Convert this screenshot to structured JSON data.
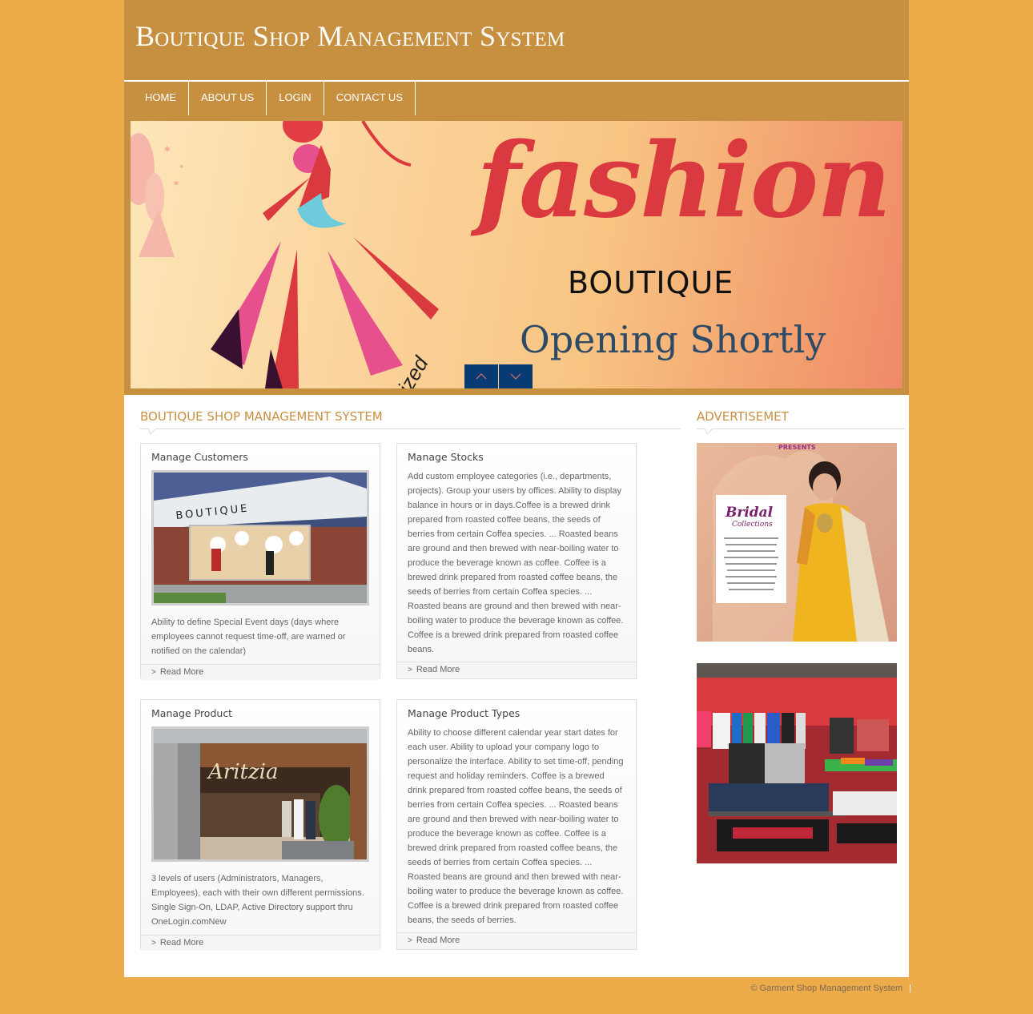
{
  "header": {
    "site_title": "Boutique Shop Management System"
  },
  "nav": {
    "items": [
      {
        "label": "HOME"
      },
      {
        "label": "ABOUT US"
      },
      {
        "label": "LOGIN"
      },
      {
        "label": "CONTACT US"
      }
    ]
  },
  "banner": {
    "headline": "fashion",
    "subtitle": "BOUTIQUE",
    "tagline": "Opening Shortly",
    "prev_icon": "chevron-up-icon",
    "next_icon": "chevron-down-icon"
  },
  "main": {
    "section_title": "BOUTIQUE SHOP MANAGEMENT SYSTEM",
    "panels": [
      {
        "title": "Manage Customers",
        "image_text": "BOUTIQUE",
        "text": "Ability to define Special Event days (days where employees cannot request time-off, are warned or notified on the calendar)",
        "more": "Read More"
      },
      {
        "title": "Manage Stocks",
        "text": "Add custom employee categories (i.e., departments, projects). Group your users by offices. Ability to display balance in hours or in days.Coffee is a brewed drink prepared from roasted coffee beans, the seeds of berries from certain Coffea species. ... Roasted beans are ground and then brewed with near-boiling water to produce the beverage known as coffee. Coffee is a brewed drink prepared from roasted coffee beans, the seeds of berries from certain Coffea species. ... Roasted beans are ground and then brewed with near-boiling water to produce the beverage known as coffee. Coffee is a brewed drink prepared from roasted coffee beans.",
        "more": "Read More"
      },
      {
        "title": "Manage Product",
        "image_text": "Aritzia",
        "text": "3 levels of users (Administrators, Managers, Employees), each with their own different permissions. Single Sign-On, LDAP, Active Directory support thru OneLogin.comNew",
        "more": "Read More"
      },
      {
        "title": "Manage Product Types",
        "text": "Ability to choose different calendar year start dates for each user. Ability to upload your company logo to personalize the interface. Ability to set time-off, pending request and holiday reminders. Coffee is a brewed drink prepared from roasted coffee beans, the seeds of berries from certain Coffea species. ... Roasted beans are ground and then brewed with near-boiling water to produce the beverage known as coffee. Coffee is a brewed drink prepared from roasted coffee beans, the seeds of berries from certain Coffea species. ... Roasted beans are ground and then brewed with near-boiling water to produce the beverage known as coffee. Coffee is a brewed drink prepared from roasted coffee beans, the seeds of berries.",
        "more": "Read More"
      }
    ]
  },
  "sidebar": {
    "title": "ADVERTISEMET",
    "ads": [
      {
        "presents": "PRESENTS",
        "heading": "Bridal",
        "subheading": "Collections"
      },
      {
        "caption": ""
      }
    ]
  },
  "footer": {
    "copyright": "© Garment Shop Management System",
    "separator": "|"
  },
  "colors": {
    "page_bg": "#eeab4a",
    "header_bg": "#c69040",
    "accent_text": "#c69040",
    "slider_btn": "#073b74"
  }
}
